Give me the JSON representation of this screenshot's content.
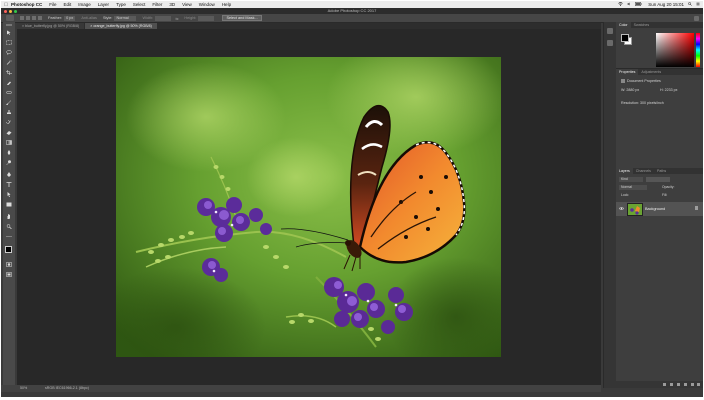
{
  "os_menubar": {
    "apple_icon": "apple-icon",
    "items": [
      "Photoshop CC",
      "File",
      "Edit",
      "Image",
      "Layer",
      "Type",
      "Select",
      "Filter",
      "3D",
      "View",
      "Window",
      "Help"
    ],
    "clock": "Sun Aug 20 15:01"
  },
  "window": {
    "title": "Adobe Photoshop CC 2017"
  },
  "options_bar": {
    "feather_label": "Feather:",
    "feather_value": "0 px",
    "antialias_label": "Anti-alias",
    "style_label": "Style:",
    "style_value": "Normal",
    "width_label": "Width:",
    "height_label": "Height:",
    "select_mask_label": "Select and Mask..."
  },
  "document_tabs": [
    {
      "label": "blue_butterfly.jpg @ 50% (RGB/8)",
      "active": false
    },
    {
      "label": "orange_butterfly.jpg @ 50% (RGB/8)",
      "active": true
    }
  ],
  "status_bar": {
    "zoom": "50%",
    "info": "sRGB IEC61966-2.1 (8bpc)"
  },
  "color_panel": {
    "tabs": [
      "Color",
      "Swatches"
    ],
    "foreground": "#000000",
    "background": "#ffffff",
    "hue": "#ff0000"
  },
  "properties_panel": {
    "tabs": [
      "Properties",
      "Adjustments"
    ],
    "title": "Document Properties",
    "width_label": "W:",
    "width_value": "2880 px",
    "height_label": "H:",
    "height_value": "2233 px",
    "resolution": "Resolution: 300 pixels/inch"
  },
  "layers_panel": {
    "tabs": [
      "Layers",
      "Channels",
      "Paths"
    ],
    "kind_filter": "Kind",
    "blend_mode": "Normal",
    "opacity_label": "Opacity:",
    "lock_label": "Lock:",
    "fill_label": "Fill:",
    "layers": [
      {
        "name": "Background",
        "locked": true
      }
    ]
  },
  "colors": {
    "ui_dark": "#3a3a3a",
    "panel": "#3e3e3e",
    "pasteboard": "#282828",
    "selected_layer": "#535353"
  }
}
